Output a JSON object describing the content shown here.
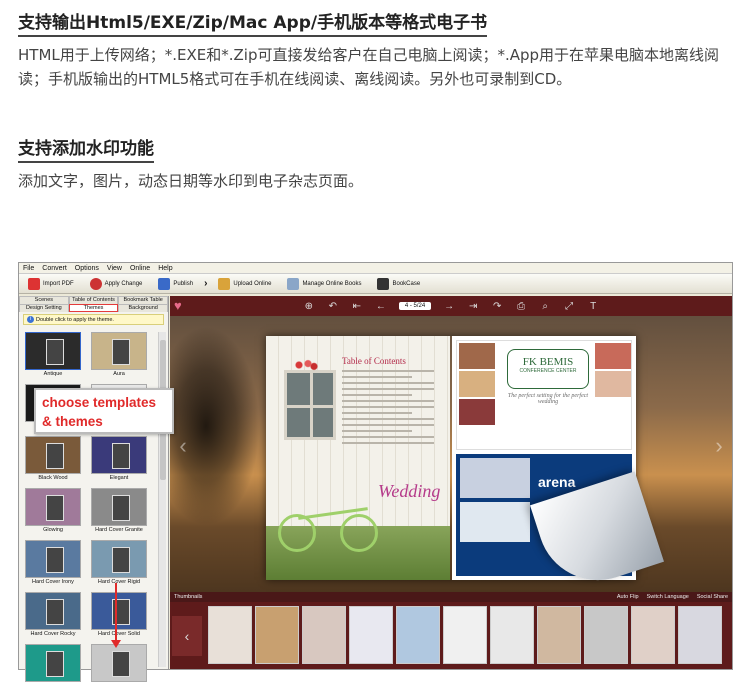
{
  "section1": {
    "title": "支持输出Html5/EXE/Zip/Mac App/手机版本等格式电子书",
    "body": "HTML用于上传网络；*.EXE和*.Zip可直接发给客户在自己电脑上阅读；*.App用于在苹果电脑本地离线阅读；手机版输出的HTML5格式可在手机在线阅读、离线阅读。另外也可录制到CD。"
  },
  "section2": {
    "title": "支持添加水印功能",
    "body": "添加文字，图片，动态日期等水印到电子杂志页面。"
  },
  "app": {
    "menu": [
      "File",
      "Convert",
      "Options",
      "View",
      "Online",
      "Help"
    ],
    "toolbar": {
      "import_pdf": "Import PDF",
      "apply_change": "Apply Change",
      "publish": "Publish",
      "upload_online": "Upload Online",
      "manage_online_books": "Manage Online Books",
      "bookcase": "BookCase"
    },
    "left_tabs_row1": [
      "Scenes",
      "Table of Contents",
      "Bookmark Table"
    ],
    "left_tabs_row2": [
      "Design Setting",
      "Themes",
      "Background"
    ],
    "hint": "Double click to apply the theme.",
    "themes": [
      {
        "label": "Antique",
        "color": "#2b2b2b"
      },
      {
        "label": "Aura",
        "color": "#c8b48a"
      },
      {
        "label": "",
        "color": "#1a1a1a"
      },
      {
        "label": "",
        "color": "#e9e9e9"
      },
      {
        "label": "Black Wood",
        "color": "#7a5a3a"
      },
      {
        "label": "Elegant",
        "color": "#3a3a7a"
      },
      {
        "label": "Glowing",
        "color": "#a07a9a"
      },
      {
        "label": "Hard Cover Granite",
        "color": "#8a8a8a"
      },
      {
        "label": "Hard Cover Irony",
        "color": "#5a7aa0"
      },
      {
        "label": "Hard Cover Rigid",
        "color": "#7a9ab0"
      },
      {
        "label": "Hard Cover Rocky",
        "color": "#4a6a8a"
      },
      {
        "label": "Hard Cover Solid",
        "color": "#3a5a9a"
      },
      {
        "label": "",
        "color": "#1e9a8a"
      },
      {
        "label": "",
        "color": "#c8c8c8"
      }
    ],
    "callout": {
      "line1": "choose templates",
      "line2": "& themes"
    },
    "viewer": {
      "page_indicator": "4 - 5/24",
      "toc_title": "Table of Contents",
      "wedding": "Wedding",
      "bemis_name": "FK BEMIS",
      "bemis_sub": "CONFERENCE CENTER",
      "tagline": "The perfect setting for the perfect wedding",
      "arena": "arena",
      "thumbnails_label": "Thumbnails",
      "auto_flip": "Auto Flip",
      "switch_language": "Switch Language",
      "social_share": "Social Share"
    },
    "thumb_colors": [
      "#e8e0d8",
      "#c8a070",
      "#d8c8c0",
      "#e8e8f0",
      "#b0c8e0",
      "#f0f0f0",
      "#e8e8e8",
      "#d0b8a0",
      "#c8c8c8",
      "#e0d0c8",
      "#d8d8e0"
    ]
  }
}
